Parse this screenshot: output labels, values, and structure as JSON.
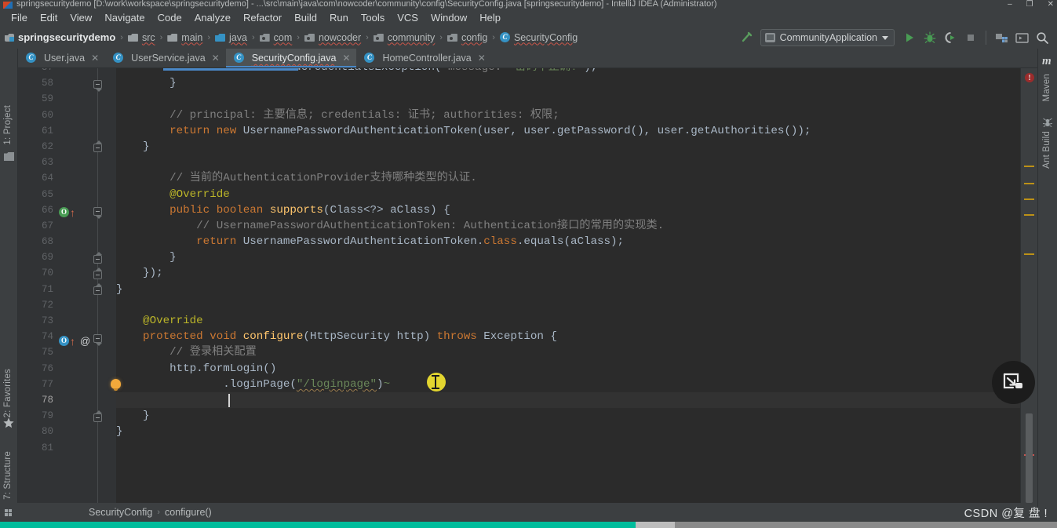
{
  "window": {
    "title": "springsecuritydemo [D:\\work\\workspace\\springsecuritydemo] - ...\\src\\main\\java\\com\\nowcoder\\community\\config\\SecurityConfig.java [springsecuritydemo] - IntelliJ IDEA (Administrator)",
    "icon": "intellij-idea-icon",
    "minimize": "–",
    "restore": "❐",
    "close": "✕"
  },
  "menu": {
    "items": [
      "File",
      "Edit",
      "View",
      "Navigate",
      "Code",
      "Analyze",
      "Refactor",
      "Build",
      "Run",
      "Tools",
      "VCS",
      "Window",
      "Help"
    ]
  },
  "breadcrumbs": {
    "items": [
      {
        "label": "springsecuritydemo",
        "icon": "module-icon",
        "squiggly": false
      },
      {
        "label": "src",
        "icon": "folder-icon",
        "squiggly": true
      },
      {
        "label": "main",
        "icon": "folder-icon",
        "squiggly": true
      },
      {
        "label": "java",
        "icon": "source-folder-icon",
        "squiggly": true
      },
      {
        "label": "com",
        "icon": "package-icon",
        "squiggly": true
      },
      {
        "label": "nowcoder",
        "icon": "package-icon",
        "squiggly": true
      },
      {
        "label": "community",
        "icon": "package-icon",
        "squiggly": true
      },
      {
        "label": "config",
        "icon": "package-icon",
        "squiggly": true
      },
      {
        "label": "SecurityConfig",
        "icon": "class-icon",
        "squiggly": true
      }
    ],
    "separator": "›"
  },
  "toolbar": {
    "build_icon": "hammer-icon",
    "run_configuration": "CommunityApplication",
    "run_config_icon": "application-icon",
    "dropdown_icon": "chevron-down-icon",
    "buttons": [
      {
        "name": "run-button",
        "icon": "play-icon"
      },
      {
        "name": "debug-button",
        "icon": "bug-icon"
      },
      {
        "name": "run-with-coverage-button",
        "icon": "coverage-icon"
      },
      {
        "name": "stop-button",
        "icon": "stop-icon"
      },
      {
        "name": "project-structure-button",
        "icon": "project-structure-icon"
      },
      {
        "name": "terminal-button",
        "icon": "terminal-icon"
      },
      {
        "name": "search-everywhere-button",
        "icon": "search-icon"
      }
    ]
  },
  "left_strip": {
    "project": "1: Project",
    "project_underline": "1",
    "favorites": "2: Favorites",
    "structure": "7: Structure",
    "project_icon": "project-folder-icon",
    "favorites_icon": "star-icon",
    "structure_icon": "structure-icon"
  },
  "right_strip": {
    "maven": "Maven",
    "maven_icon": "maven-m-icon",
    "ant": "Ant Build",
    "ant_icon": "ant-icon"
  },
  "tabs": [
    {
      "label": "User.java",
      "icon": "java-class-icon",
      "active": false,
      "close": "✕"
    },
    {
      "label": "UserService.java",
      "icon": "java-class-icon",
      "active": false,
      "close": "✕"
    },
    {
      "label": "SecurityConfig.java",
      "icon": "java-class-icon",
      "active": true,
      "close": "✕"
    },
    {
      "label": "HomeController.java",
      "icon": "java-class-icon",
      "active": false,
      "close": "✕"
    }
  ],
  "editor": {
    "clipped_top_line": "            throw new BadCredentialsException( message: \"密码不正确!\");",
    "first_visible_line_number": 57,
    "lines": [
      {
        "n": 58,
        "fold": "minus-end",
        "text": "        }"
      },
      {
        "n": 59,
        "text": ""
      },
      {
        "n": 60,
        "text": "        // principal: 主要信息; credentials: 证书; authorities: 权限;"
      },
      {
        "n": 61,
        "text": "        return new UsernamePasswordAuthenticationToken(user, user.getPassword(), user.getAuthorities());"
      },
      {
        "n": 62,
        "fold": "end",
        "text": "    }"
      },
      {
        "n": 63,
        "text": ""
      },
      {
        "n": 64,
        "text": "        // 当前的AuthenticationProvider支持哪种类型的认证."
      },
      {
        "n": 65,
        "text": "        @Override"
      },
      {
        "n": 66,
        "marker": "override-green",
        "fold": "minus",
        "text": "        public boolean supports(Class<?> aClass) {"
      },
      {
        "n": 67,
        "text": "            // UsernamePasswordAuthenticationToken: Authentication接口的常用的实现类."
      },
      {
        "n": 68,
        "text": "            return UsernamePasswordAuthenticationToken.class.equals(aClass);"
      },
      {
        "n": 69,
        "fold": "end",
        "text": "        }"
      },
      {
        "n": 70,
        "fold": "end",
        "text": "    });"
      },
      {
        "n": 71,
        "fold": "end",
        "text": "}"
      },
      {
        "n": 72,
        "text": ""
      },
      {
        "n": 73,
        "text": "    @Override"
      },
      {
        "n": 74,
        "marker": "override-blue",
        "marker2": "at-sign",
        "fold": "minus",
        "text": "    protected void configure(HttpSecurity http) throws Exception {"
      },
      {
        "n": 75,
        "text": "        // 登录相关配置"
      },
      {
        "n": 76,
        "text": "        http.formLogin()"
      },
      {
        "n": 77,
        "marker": "intention-bulb",
        "text": "                .loginPage(\"/loginpage\")"
      },
      {
        "n": 78,
        "current": true,
        "text": ""
      },
      {
        "n": 79,
        "fold": "end",
        "text": "    }"
      },
      {
        "n": 80,
        "text": "}"
      },
      {
        "n": 81,
        "text": ""
      }
    ]
  },
  "status": {
    "breadcrumb_class": "SecurityConfig",
    "breadcrumb_method": "configure()",
    "breadcrumb_separator": "›",
    "watermark": "CSDN @复 盘 !",
    "progress_percent": 60
  },
  "colors": {
    "accent_blue": "#4a88c7",
    "editor_bg": "#2b2b2b",
    "chrome_bg": "#3c3f41",
    "keyword_orange": "#cc7832",
    "string_green": "#6a8759",
    "method_yellow": "#ffc66d",
    "comment_gray": "#808080",
    "progress_teal": "#00bd9c",
    "error_red": "#c75450",
    "warning_amber": "#bc9117"
  },
  "floating_widget": {
    "icon": "screen-capture-widget-icon"
  }
}
